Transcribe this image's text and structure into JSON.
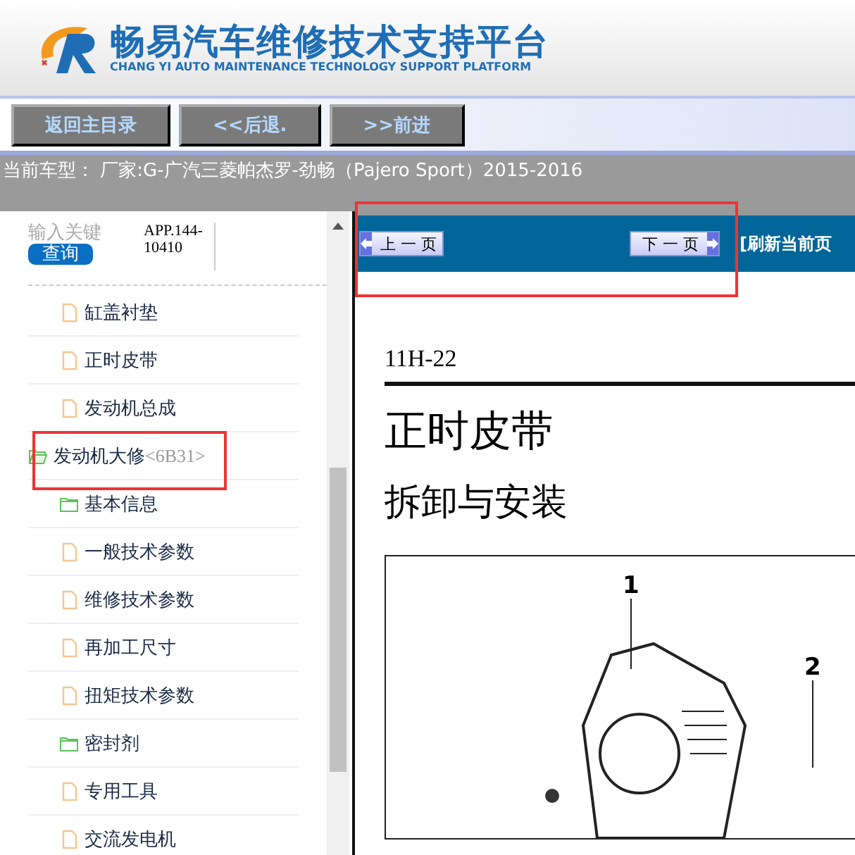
{
  "header": {
    "title": "畅易汽车维修技术支持平台",
    "subtitle": "CHANG YI AUTO MAINTENANCE TECHNOLOGY SUPPORT PLATFORM"
  },
  "nav_buttons": [
    "返回主目录",
    "<<后退.",
    ">>前进"
  ],
  "current_vehicle": "当前车型： 厂家:G-广汽三菱帕杰罗-劲畅（Pajero Sport）2015-2016",
  "search": {
    "placeholder": "输入关键",
    "button": "查询",
    "code": "APP.144-10410"
  },
  "tree": [
    {
      "kind": "page",
      "label": "缸盖衬垫"
    },
    {
      "kind": "page",
      "label": "正时皮带"
    },
    {
      "kind": "page",
      "label": "发动机总成"
    },
    {
      "kind": "folder",
      "label": "发动机大修",
      "code": "<6B31>",
      "expanded": true,
      "children": [
        {
          "kind": "folder",
          "label": "基本信息",
          "expanded": false
        },
        {
          "kind": "page",
          "label": "一般技术参数"
        },
        {
          "kind": "page",
          "label": "维修技术参数"
        },
        {
          "kind": "page",
          "label": "再加工尺寸"
        },
        {
          "kind": "page",
          "label": "扭矩技术参数"
        },
        {
          "kind": "folder",
          "label": "密封剂",
          "expanded": false
        },
        {
          "kind": "page",
          "label": "专用工具"
        },
        {
          "kind": "page",
          "label": "交流发电机"
        }
      ]
    }
  ],
  "viewer": {
    "prev": "上 一 页",
    "next": "下 一 页",
    "refresh": "[刷新当前页"
  },
  "document": {
    "page_number": "11H-22",
    "title": "正时皮带",
    "subtitle": "拆卸与安装",
    "callouts": [
      "1",
      "2"
    ]
  }
}
